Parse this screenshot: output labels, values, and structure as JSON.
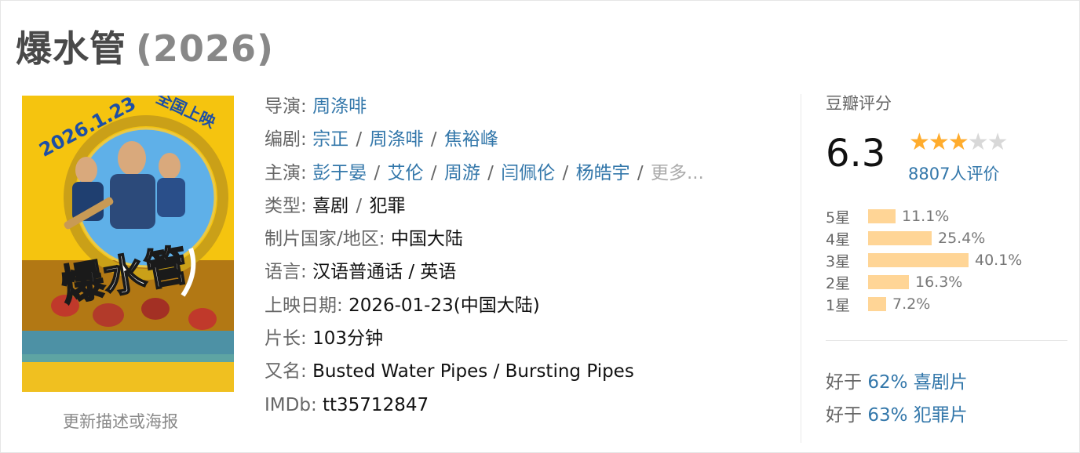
{
  "title": {
    "name": "爆水管",
    "year": "(2026)"
  },
  "poster": {
    "date_text": "2026.1.23",
    "release_text": "全国上映",
    "logo_text": "爆水管",
    "update_link": "更新描述或海报"
  },
  "info": {
    "director": {
      "label": "导演: ",
      "names": [
        "周涤啡"
      ]
    },
    "writers": {
      "label": "编剧: ",
      "names": [
        "宗正",
        "周涤啡",
        "焦裕峰"
      ]
    },
    "cast": {
      "label": "主演: ",
      "names": [
        "彭于晏",
        "艾伦",
        "周游",
        "闫佩伦",
        "杨皓宇"
      ],
      "more": "更多..."
    },
    "genre": {
      "label": "类型: ",
      "values": [
        "喜剧",
        "犯罪"
      ]
    },
    "country": {
      "label": "制片国家/地区: ",
      "value": "中国大陆"
    },
    "language": {
      "label": "语言: ",
      "value": "汉语普通话 / 英语"
    },
    "release": {
      "label": "上映日期: ",
      "value": "2026-01-23(中国大陆)"
    },
    "runtime": {
      "label": "片长: ",
      "value": "103分钟"
    },
    "aka": {
      "label": "又名: ",
      "value": "Busted Water Pipes / Bursting Pipes"
    },
    "imdb": {
      "label": "IMDb: ",
      "value": "tt35712847"
    }
  },
  "rating": {
    "label": "豆瓣评分",
    "score": "6.3",
    "stars": 3,
    "count": "8807人评价",
    "distribution": [
      {
        "label": "5星",
        "pct": "11.1%",
        "value": 11.1
      },
      {
        "label": "4星",
        "pct": "25.4%",
        "value": 25.4
      },
      {
        "label": "3星",
        "pct": "40.1%",
        "value": 40.1
      },
      {
        "label": "2星",
        "pct": "16.3%",
        "value": 16.3
      },
      {
        "label": "1星",
        "pct": "7.2%",
        "value": 7.2
      }
    ],
    "compare": [
      {
        "prefix": "好于 ",
        "pct": "62%",
        "genre": " 喜剧片"
      },
      {
        "prefix": "好于 ",
        "pct": "63%",
        "genre": " 犯罪片"
      }
    ]
  },
  "colors": {
    "link": "#3377aa",
    "star": "#ffac2d",
    "bar": "#ffd596",
    "poster_bg": "#f5c40f"
  }
}
